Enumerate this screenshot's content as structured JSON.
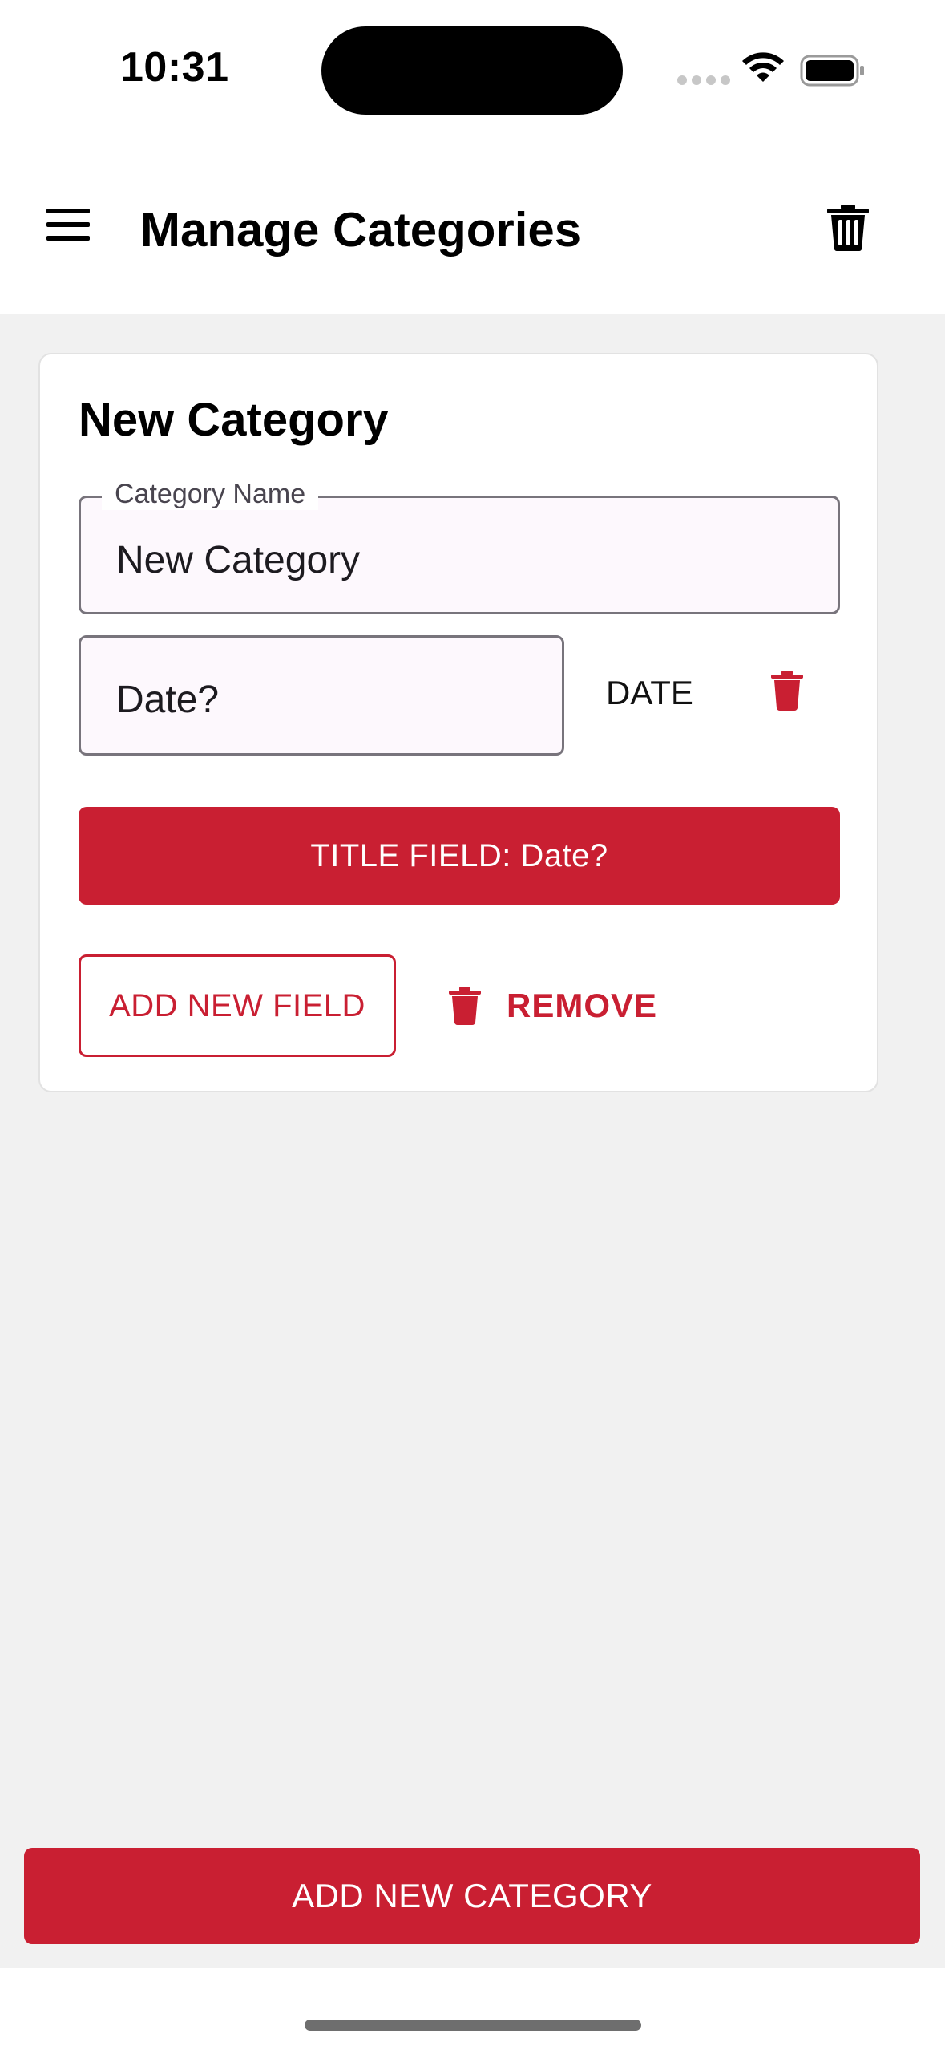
{
  "status_bar": {
    "time": "10:31",
    "icons": [
      "cellular-signal-icon",
      "wifi-icon",
      "battery-icon"
    ]
  },
  "app_bar": {
    "title": "Manage Categories",
    "icons": {
      "menu": "menu-icon",
      "delete_all": "trash-icon"
    }
  },
  "category_card": {
    "title": "New Category",
    "name_field": {
      "label": "Category Name",
      "value": "New Category"
    },
    "fields": [
      {
        "value": "Date?",
        "type": "DATE",
        "delete_icon": "trash-icon"
      }
    ],
    "title_field_button": "TITLE FIELD: Date?",
    "add_field_button": "ADD NEW FIELD",
    "remove_button": "REMOVE"
  },
  "footer": {
    "add_category_button": "ADD NEW CATEGORY"
  },
  "colors": {
    "accent": "#c91f32",
    "background": "#f1f1f1",
    "card": "#ffffff",
    "input_fill": "#fdf8fd",
    "input_border": "#78747c"
  }
}
